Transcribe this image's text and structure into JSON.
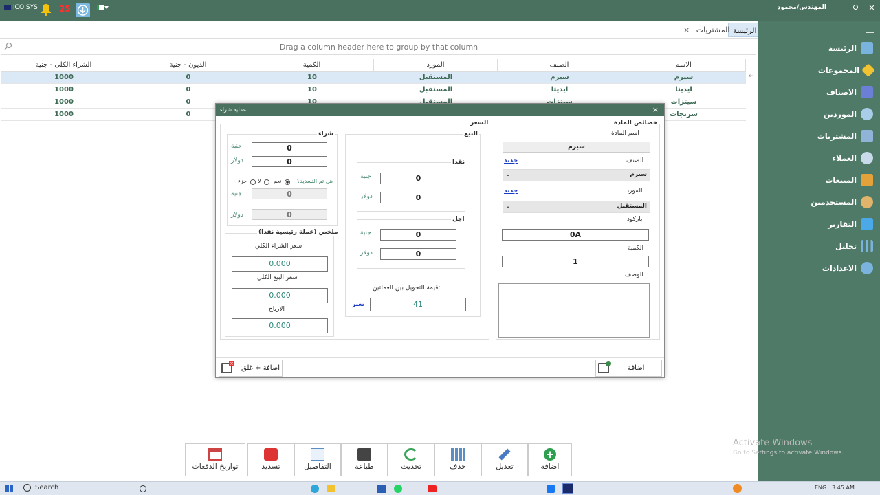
{
  "titlebar": {
    "app_name": "ICO SYS",
    "notif_count": "25",
    "user": "المهندس/محمود سعد"
  },
  "sidebar": {
    "items": [
      {
        "label": "الرئيسة"
      },
      {
        "label": "المجموعات"
      },
      {
        "label": "الاصناف"
      },
      {
        "label": "الموردين"
      },
      {
        "label": "المشتريات"
      },
      {
        "label": "العملاء"
      },
      {
        "label": "المبيعات"
      },
      {
        "label": "المستخدمين"
      },
      {
        "label": "التقارير"
      },
      {
        "label": "تحليل"
      },
      {
        "label": "الاعدادات"
      }
    ]
  },
  "tabs": {
    "home": "الرئيسة",
    "purchases": "المشتريات",
    "close": "×"
  },
  "grid": {
    "group_hint": "Drag a column header here to group by that column",
    "columns": [
      "الاسم",
      "الصنف",
      "المورد",
      "الكمية",
      "الديون - جنية",
      "الشراء الكلى - جنية"
    ],
    "rows": [
      {
        "name": "سيرم",
        "category": "سيرم",
        "supplier": "المستقبل",
        "qty": "10",
        "debt": "0",
        "total": "1000"
      },
      {
        "name": "ايديتا",
        "category": "ايديتا",
        "supplier": "المستقبل",
        "qty": "10",
        "debt": "0",
        "total": "1000"
      },
      {
        "name": "سيتزات",
        "category": "سيتزات",
        "supplier": "المستقبل",
        "qty": "10",
        "debt": "0",
        "total": "1000"
      },
      {
        "name": "سرنجات",
        "category": "",
        "supplier": "",
        "qty": "",
        "debt": "0",
        "total": "1000"
      }
    ]
  },
  "dialog": {
    "title": "عملية شراء",
    "close": "×",
    "props": {
      "title": "خصائص المادة",
      "name_label": "اسم المادة",
      "name_value": "سيرم",
      "category_label": "الصنف",
      "category_new": "جديد",
      "category_value": "سيرم",
      "supplier_label": "المورد",
      "supplier_new": "جديد",
      "supplier_value": "المستقبل",
      "barcode_label": "باركود",
      "barcode_value": "0A",
      "qty_label": "الكمية",
      "qty_value": "1",
      "desc_label": "الوصف"
    },
    "price": {
      "title": "السعر",
      "sell": {
        "title": "البيع",
        "cash": {
          "title": "نقدا",
          "egp_label": "جنية",
          "egp_value": "0",
          "usd_label": "دولار",
          "usd_value": "0"
        },
        "credit": {
          "title": "اجل",
          "egp_label": "جنية",
          "egp_value": "0",
          "usd_label": "دولار",
          "usd_value": "0"
        },
        "rate_label": "قيمة التحويل بين العملتين:",
        "rate_value": "41",
        "rate_change": "تغير"
      },
      "buy": {
        "title": "شراء",
        "egp_label": "جنية",
        "egp_value": "0",
        "usd_label": "دولار",
        "usd_value": "0",
        "paid_q": "هل تم التسديد؟",
        "yes": "نعم",
        "no": "لا",
        "part": "جزء",
        "paid_egp_label": "جنية",
        "paid_egp_value": "0",
        "paid_usd_label": "دولار",
        "paid_usd_value": "0"
      },
      "summary": {
        "title": "ملخص (عملة رئيسية نقدا)",
        "total_buy_label": "سعر الشراء الكلي",
        "total_buy": "0.000",
        "total_sell_label": "سعر البيع الكلي",
        "total_sell": "0.000",
        "profit_label": "الارباح",
        "profit": "0.000"
      }
    },
    "add_btn": "اضافة",
    "add_close_btn": "اضافة + غلق"
  },
  "toolbar": [
    {
      "label": "تواريخ الدفعات"
    },
    {
      "label": "تسديد"
    },
    {
      "label": "التفاصيل"
    },
    {
      "label": "طباعة"
    },
    {
      "label": "تحديث"
    },
    {
      "label": "حذف"
    },
    {
      "label": "تعديل"
    },
    {
      "label": "اضافة"
    }
  ],
  "watermark": {
    "line1": "Activate Windows",
    "line2": "Go to Settings to activate Windows."
  },
  "taskbar": {
    "search": "Search",
    "lang": "ENG",
    "time": "3:45 AM"
  }
}
